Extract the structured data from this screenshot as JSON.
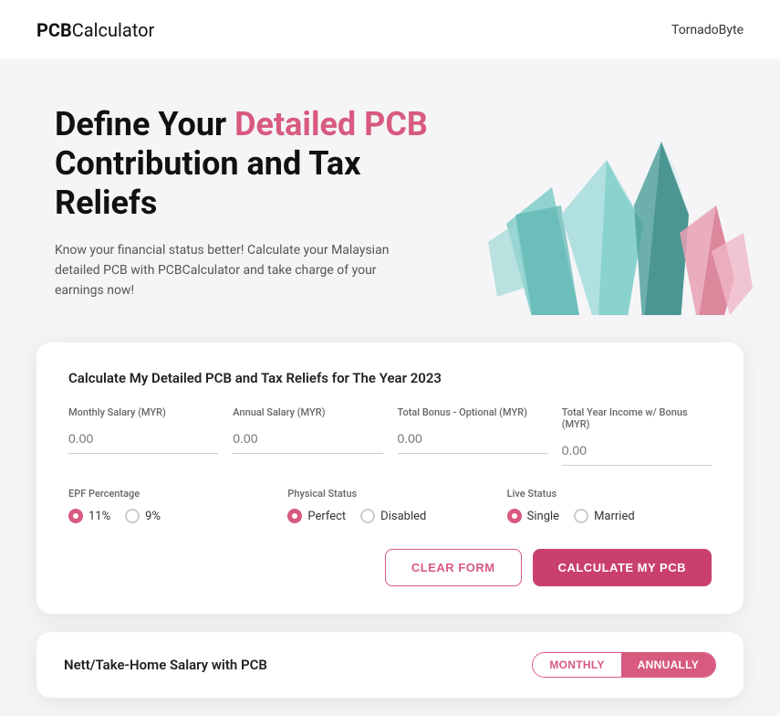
{
  "header": {
    "logo_bold": "PCB",
    "logo_regular": "Calculator",
    "nav_link": "TornadoByte"
  },
  "hero": {
    "title_part1": "Define Your ",
    "title_highlight": "Detailed PCB",
    "title_part2": " Contribution and Tax Reliefs",
    "subtitle": "Know your financial status better! Calculate your Malaysian detailed PCB with PCBCalculator and take charge of your earnings now!"
  },
  "card": {
    "title": "Calculate My Detailed PCB and Tax Reliefs for The Year 2023",
    "fields": [
      {
        "label": "Monthly Salary (MYR)",
        "placeholder": "0.00",
        "value": ""
      },
      {
        "label": "Annual Salary (MYR)",
        "placeholder": "0.00",
        "value": ""
      },
      {
        "label": "Total Bonus - Optional (MYR)",
        "placeholder": "0.00",
        "value": ""
      },
      {
        "label": "Total Year Income w/ Bonus (MYR)",
        "placeholder": "0.00",
        "value": "",
        "readonly": true
      }
    ],
    "epf": {
      "label": "EPF Percentage",
      "options": [
        "11%",
        "9%"
      ],
      "selected": "11%"
    },
    "physical": {
      "label": "Physical Status",
      "options": [
        "Perfect",
        "Disabled"
      ],
      "selected": "Perfect"
    },
    "live": {
      "label": "Live Status",
      "options": [
        "Single",
        "Married"
      ],
      "selected": "Single"
    },
    "btn_clear": "CLEAR FORM",
    "btn_calculate": "CALCULATE MY PCB"
  },
  "nett": {
    "title": "Nett/Take-Home Salary with PCB",
    "toggle_monthly": "MONTHLY",
    "toggle_annually": "ANNUALLY",
    "active_toggle": "ANNUALLY"
  },
  "colors": {
    "accent": "#d85a7f",
    "accent_dark": "#c94070"
  }
}
